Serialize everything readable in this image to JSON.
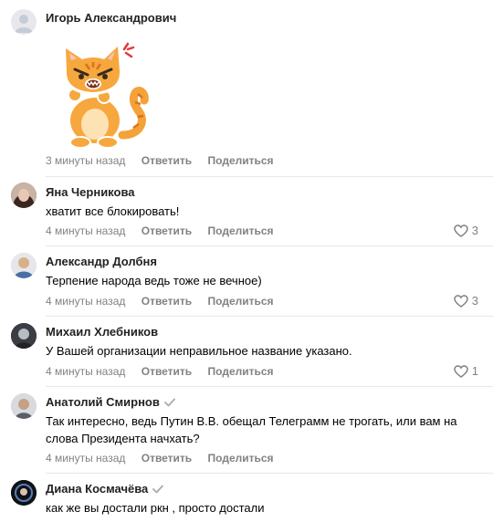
{
  "comments": [
    {
      "author": "Игорь Александрович",
      "sticker": "angry-orange-cat-sticker",
      "time": "3 минуты назад",
      "reply": "Ответить",
      "share": "Поделиться"
    },
    {
      "author": "Яна Черникова",
      "text": "хватит все блокировать!",
      "time": "4 минуты назад",
      "reply": "Ответить",
      "share": "Поделиться",
      "likes": "3"
    },
    {
      "author": "Александр Долбня",
      "text": "Терпение народа ведь тоже не вечное)",
      "time": "4 минуты назад",
      "reply": "Ответить",
      "share": "Поделиться",
      "likes": "3"
    },
    {
      "author": "Михаил Хлебников",
      "text": "У Вашей организации неправильное название указано.",
      "time": "4 минуты назад",
      "reply": "Ответить",
      "share": "Поделиться",
      "likes": "1"
    },
    {
      "author": "Анатолий Смирнов",
      "verified": true,
      "text": "Так интересно, ведь Путин В.В. обещал Телеграмм не трогать, или вам на слова Президента начхать?",
      "time": "4 минуты назад",
      "reply": "Ответить",
      "share": "Поделиться"
    },
    {
      "author": "Диана Космачёва",
      "verified": true,
      "text": "как же вы достали ркн , просто достали"
    }
  ],
  "colors": {
    "meta": "#828282",
    "divider": "#e7e8ec",
    "verified": "#aaaaaa"
  }
}
